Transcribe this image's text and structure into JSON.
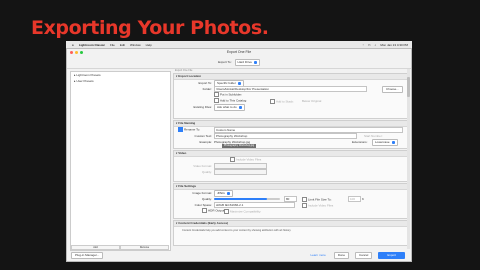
{
  "slide": {
    "title": "Exporting Your Photos."
  },
  "menubar": {
    "apple": "",
    "app": "Lightroom Classic",
    "items": [
      "File",
      "Edit",
      "Window",
      "Help"
    ],
    "clock": "Mon Jan 13  4:30 PM"
  },
  "dialog": {
    "title": "Export One File",
    "export_to_label": "Export To:",
    "export_to_value": "Hard Drive",
    "breadcrumb": "Export One File",
    "sidebar_items": [
      "▸ Lightroom Presets",
      "▸ User Presets"
    ],
    "add_label": "Add",
    "remove_label": "Remove",
    "plugin_manager_label": "Plug-in Manager...",
    "sections": {
      "export_location": {
        "title": "Export Location",
        "export_to_label": "Export To:",
        "export_to_value": "Specific folder",
        "folder_label": "Folder:",
        "folder_value": "/Users/kimkat/Desktop/For Presentation",
        "choose_label": "Choose...",
        "put_in_subfolder": "Put in Subfolder:",
        "add_to_catalog": "Add to This Catalog",
        "add_to_stack": "Add to Stack:",
        "below_original": "Below Original",
        "existing_files_label": "Existing Files:",
        "existing_files_value": "Ask what to do"
      },
      "file_naming": {
        "title": "File Naming",
        "rename_to": "Rename To:",
        "rename_value": "Custom Name",
        "custom_text_label": "Custom Text:",
        "custom_text_value": "Photography Workshop",
        "start_number_label": "Start Number:",
        "example_label": "Example:",
        "example_value": "Photography Workshop.jpg",
        "extensions_label": "Extensions:",
        "extensions_value": "Lowercase",
        "tooltip": "Photography Workshop.jpg"
      },
      "video": {
        "title": "Video",
        "include_video": "Include Video Files",
        "video_format_label": "Video Format:",
        "quality_label": "Quality:"
      },
      "file_settings": {
        "title": "File Settings",
        "image_format_label": "Image Format:",
        "image_format_value": "JPEG",
        "quality_label": "Quality:",
        "quality_value": "80",
        "quality_fraction": 0.8,
        "limit_file_size": "Limit File Size To:",
        "limit_value": "100",
        "limit_unit": "K",
        "color_space_label": "Color Space:",
        "color_space_value": "sRGB IEC61966-2.1",
        "hdr_output": "HDR Output",
        "include_video": "Include Video Files",
        "maximize_compat": "Maximize Compatibility"
      },
      "content_credentials": {
        "title": "Content Credentials (Early Access)",
        "body": "Content Credentials help you add context to your content by showing attribution with art history."
      }
    },
    "footer": {
      "learn_more": "Learn more",
      "done": "Done",
      "cancel": "Cancel",
      "export": "Export"
    }
  },
  "colors": {
    "title_red": "#e8372a",
    "accent_blue": "#2d7ff9",
    "background": "#141414"
  }
}
